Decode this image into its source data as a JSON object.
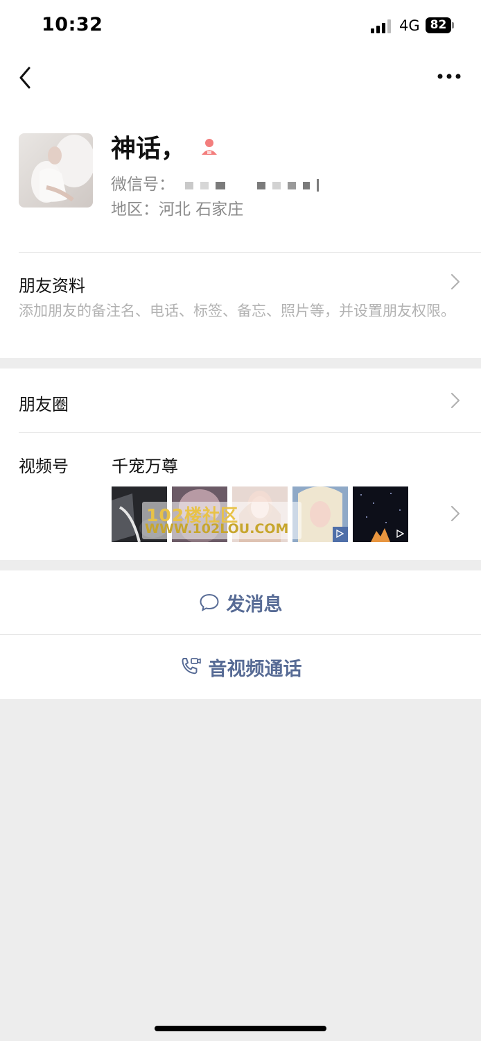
{
  "status_bar": {
    "time": "10:32",
    "network": "4G",
    "battery": "82"
  },
  "profile": {
    "name": "神话，",
    "wechat_id_label": "微信号：",
    "region_label": "地区：",
    "region_value": "河北 石家庄"
  },
  "friend_info": {
    "title": "朋友资料",
    "description": "添加朋友的备注名、电话、标签、备忘、照片等，并设置朋友权限。"
  },
  "moments": {
    "title": "朋友圈"
  },
  "channels": {
    "title": "视频号",
    "name": "千宠万尊",
    "watermark_line1": "102楼社区",
    "watermark_line2": "WWW.102LOU.COM"
  },
  "actions": {
    "message": "发消息",
    "call": "音视频通话"
  },
  "colors": {
    "link_blue": "#576b95",
    "gender_female": "#f37e7d",
    "background": "#ededed"
  }
}
